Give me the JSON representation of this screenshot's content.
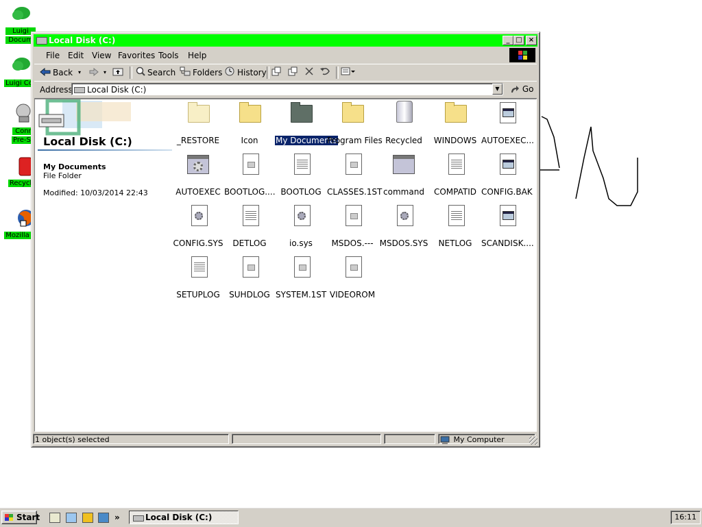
{
  "desktop": {
    "icons": [
      {
        "label1": "Luigi",
        "label2": "Docum"
      },
      {
        "label1": "Luigi Cor",
        "label2": ""
      },
      {
        "label1": "Conn",
        "label2": "Pre-Se"
      },
      {
        "label1": "Recycl",
        "label2": ""
      },
      {
        "label1": "Mozilla F",
        "label2": ""
      }
    ]
  },
  "window": {
    "title": "Local Disk (C:)",
    "controls": {
      "minimize": "_",
      "maximize": "□",
      "close": "×"
    },
    "menu": [
      "File",
      "Edit",
      "View",
      "Favorites",
      "Tools",
      "Help"
    ],
    "toolbar": {
      "back": "Back",
      "search": "Search",
      "folders": "Folders",
      "history": "History"
    },
    "address": {
      "label": "Address",
      "value": "Local Disk (C:)",
      "go": "Go"
    },
    "left_pane": {
      "folder_title": "Local Disk (C:)",
      "selected_name": "My Documents",
      "selected_type": "File Folder",
      "selected_modified": "Modified: 10/03/2014 22:43"
    },
    "files": [
      {
        "name": "_RESTORE",
        "icon": "folder-light"
      },
      {
        "name": "Icon",
        "icon": "folder"
      },
      {
        "name": "My Documents",
        "icon": "folder-dark",
        "selected": true
      },
      {
        "name": "Program Files",
        "icon": "folder"
      },
      {
        "name": "Recycled",
        "icon": "recycle"
      },
      {
        "name": "WINDOWS",
        "icon": "folder"
      },
      {
        "name": "AUTOEXEC...",
        "icon": "doc-win"
      },
      {
        "name": "AUTOEXEC",
        "icon": "app-gear"
      },
      {
        "name": "BOOTLOG....",
        "icon": "doc-badge"
      },
      {
        "name": "BOOTLOG",
        "icon": "doc-lines"
      },
      {
        "name": "CLASSES.1ST",
        "icon": "doc-badge"
      },
      {
        "name": "command",
        "icon": "app-window"
      },
      {
        "name": "COMPATID",
        "icon": "doc-lines"
      },
      {
        "name": "CONFIG.BAK",
        "icon": "doc-win"
      },
      {
        "name": "CONFIG.SYS",
        "icon": "doc-gear"
      },
      {
        "name": "DETLOG",
        "icon": "doc-lines"
      },
      {
        "name": "io.sys",
        "icon": "doc-gear"
      },
      {
        "name": "MSDOS.---",
        "icon": "doc-badge"
      },
      {
        "name": "MSDOS.SYS",
        "icon": "doc-gear"
      },
      {
        "name": "NETLOG",
        "icon": "doc-lines"
      },
      {
        "name": "SCANDISK....",
        "icon": "doc-win"
      },
      {
        "name": "SETUPLOG",
        "icon": "doc-lines"
      },
      {
        "name": "SUHDLOG",
        "icon": "doc-badge"
      },
      {
        "name": "SYSTEM.1ST",
        "icon": "doc-badge"
      },
      {
        "name": "VIDEOROM",
        "icon": "doc-badge"
      }
    ],
    "status": {
      "selection": "1 object(s) selected",
      "zone": "My Computer"
    }
  },
  "taskbar": {
    "start": "Start",
    "task_button": "Local Disk (C:)",
    "clock": "16:11",
    "chevron": "»"
  },
  "colors": {
    "title_bar": "#00ff00",
    "desktop_label_bg": "#00d800",
    "selection": "#0a246a"
  }
}
